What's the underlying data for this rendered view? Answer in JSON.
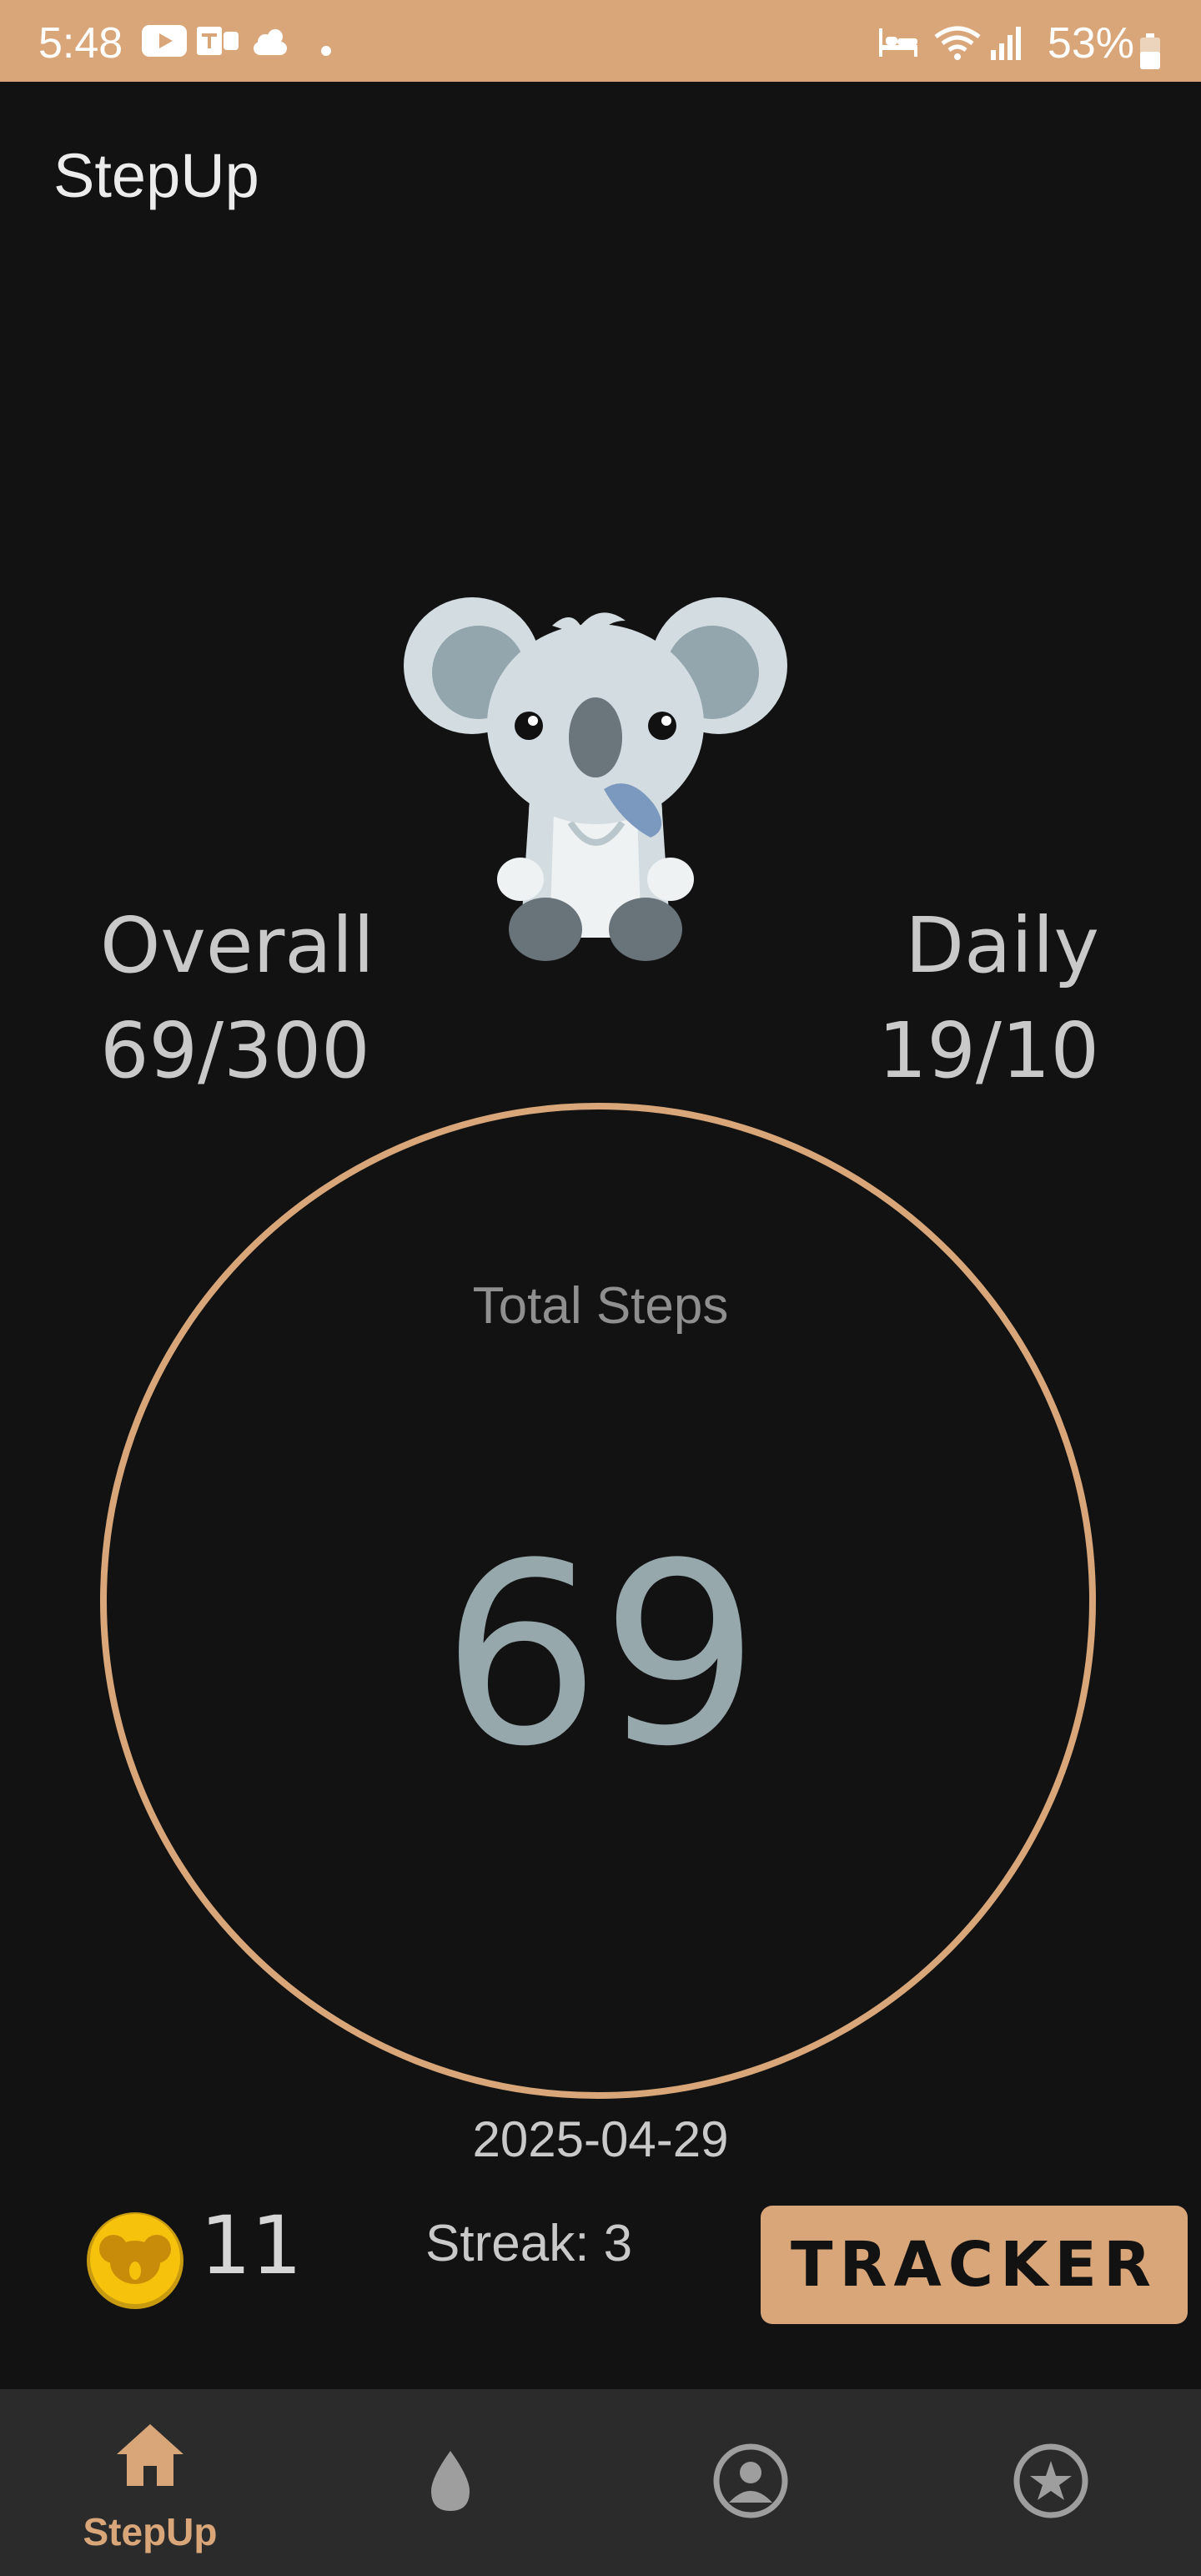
{
  "status_bar": {
    "time": "5:48",
    "battery": "53%",
    "icons": [
      "youtube-icon",
      "teams-icon",
      "weather-icon",
      "dot-icon",
      "bed-icon",
      "wifi-icon",
      "signal-icon",
      "battery-icon"
    ]
  },
  "app": {
    "title": "StepUp"
  },
  "stats": {
    "overall_label": "Overall",
    "overall_value": "69/300",
    "daily_label": "Daily",
    "daily_value": "19/10"
  },
  "steps": {
    "label": "Total Steps",
    "value": "69",
    "date": "2025-04-29"
  },
  "footer_row": {
    "coins": "11",
    "streak": "Streak: 3",
    "tracker_button": "TRACKER"
  },
  "nav": {
    "items": [
      {
        "label": "StepUp",
        "icon": "home-icon",
        "active": true
      },
      {
        "label": "",
        "icon": "drop-icon",
        "active": false
      },
      {
        "label": "",
        "icon": "profile-icon",
        "active": false
      },
      {
        "label": "",
        "icon": "star-icon",
        "active": false
      }
    ]
  },
  "colors": {
    "accent": "#d9a679",
    "background": "#121212",
    "navbar": "#2b2b2b",
    "steps_value": "#97a8ad"
  }
}
